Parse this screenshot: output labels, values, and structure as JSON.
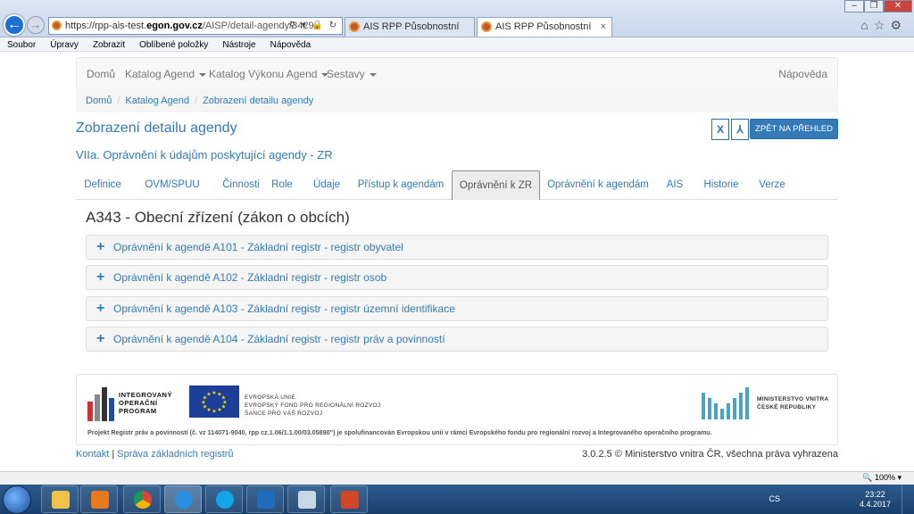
{
  "browser": {
    "url_prefix": "https://rpp-ais-test.",
    "url_domain": "egon.gov.cz",
    "url_path": "/AISP/detail-agendy/3429",
    "tabs": [
      {
        "label": "AIS RPP Působnostní"
      },
      {
        "label": "AIS RPP Působnostní"
      }
    ],
    "menu": [
      "Soubor",
      "Úpravy",
      "Zobrazit",
      "Oblíbené položky",
      "Nástroje",
      "Nápověda"
    ],
    "zoom": "100%"
  },
  "navbar": {
    "items": [
      {
        "label": "Domů"
      },
      {
        "label": "Katalog Agend"
      },
      {
        "label": "Katalog Výkonu Agend"
      },
      {
        "label": "Sestavy"
      }
    ],
    "help": "Nápověda"
  },
  "breadcrumb": [
    "Domů",
    "Katalog Agend",
    "Zobrazení detailu agendy"
  ],
  "page": {
    "title": "Zobrazení detailu agendy",
    "subtitle": "VIIa. Oprávnění k údajům poskytující agendy - ZR",
    "back_button": "ZPĚT NA PŘEHLED",
    "export_excel_label": "X",
    "export_pdf_label": "⅄"
  },
  "tabs": [
    {
      "label": "Definice"
    },
    {
      "label": "OVM/SPUU"
    },
    {
      "label": "Činnosti"
    },
    {
      "label": "Role"
    },
    {
      "label": "Údaje"
    },
    {
      "label": "Přístup k agendám"
    },
    {
      "label": "Oprávnění k ZR",
      "active": true
    },
    {
      "label": "Oprávnění k agendám"
    },
    {
      "label": "AIS"
    },
    {
      "label": "Historie"
    },
    {
      "label": "Verze"
    }
  ],
  "section": {
    "title": "A343 - Obecní zřízení (zákon o obcích)",
    "panels": [
      {
        "label": "Oprávnění k agendě A101 - Základní registr - registr obyvatel"
      },
      {
        "label": "Oprávnění k agendě A102 - Základní registr - registr osob"
      },
      {
        "label": "Oprávnění k agendě A103 - Základní registr - registr územní identifikace"
      },
      {
        "label": "Oprávnění k agendě A104 - Základní registr - registr práv a povinností"
      }
    ]
  },
  "footer": {
    "iop_lines": [
      "INTEGROVANÝ",
      "OPERAČNÍ",
      "PROGRAM"
    ],
    "eu_lines": [
      "EVROPSKÁ UNIE",
      "EVROPSKÝ FOND PRO REGIONÁLNÍ ROZVOJ",
      "ŠANCE PRO VÁŠ ROZVOJ"
    ],
    "mv_lines": [
      "MINISTERSTVO VNITRA",
      "ČESKÉ REPUBLIKY"
    ],
    "project_text": "Projekt Registr práv a povinností (č. vz 114071-9040, rpp cz.1.06/1.1.00/03.05890\") je spolufinancován Evropskou unií v rámci Evropského fondu pro regionální rozvoj a Integrovaného operačního programu.",
    "link_contact": "Kontakt",
    "link_sep": "|",
    "link_registers": "Správa základních registrů",
    "copyright": "3.0.2.5 © Ministerstvo vnitra ČR, všechna práva vyhrazena"
  },
  "taskbar": {
    "lang": "CS",
    "time": "23:22",
    "date": "4.4.2017"
  },
  "colors": {
    "link": "#337ab7",
    "taskbar": "#1a3f6b"
  }
}
